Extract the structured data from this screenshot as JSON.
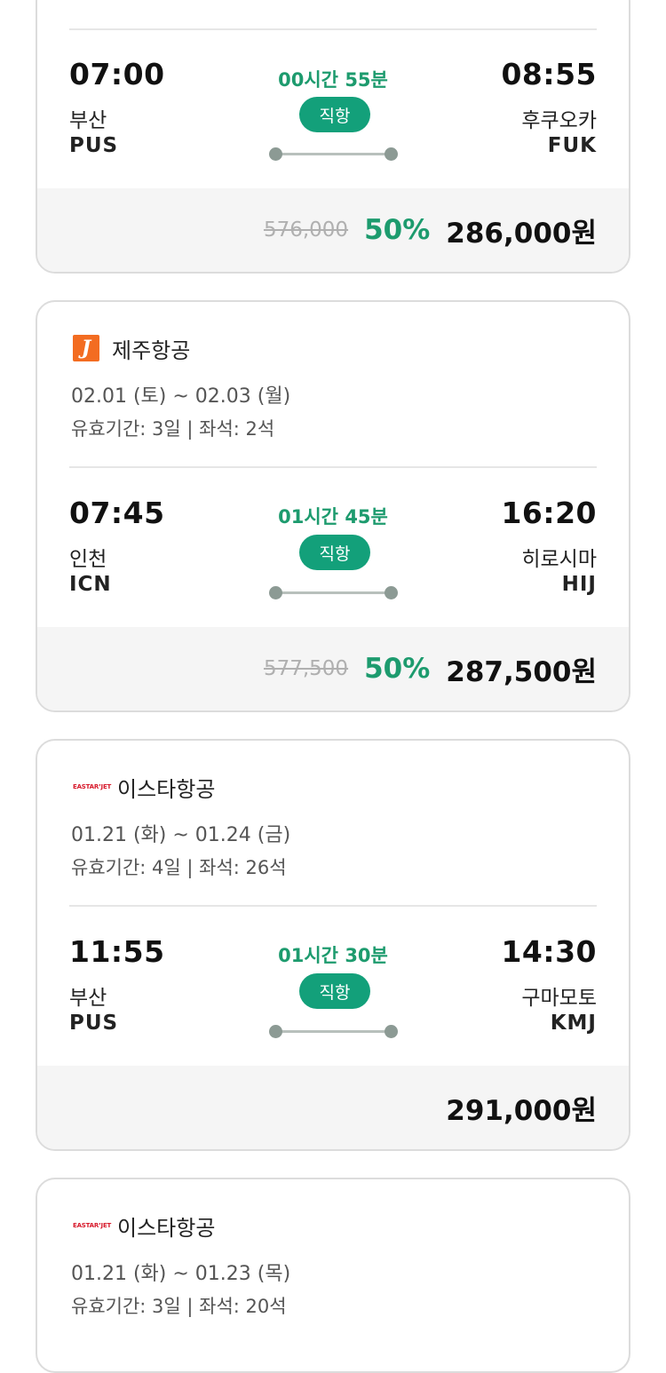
{
  "cards": [
    {
      "dep_time": "07:00",
      "dep_city": "부산",
      "dep_code": "PUS",
      "arr_time": "08:55",
      "arr_city": "후쿠오카",
      "arr_code": "FUK",
      "duration": "00시간 55분",
      "badge": "직항",
      "orig_price": "576,000",
      "discount": "50%",
      "price": "286,000원"
    },
    {
      "airline": "제주항공",
      "logo_letter": "J",
      "dates": "02.01 (토) ~ 02.03 (월)",
      "validity": "유효기간: 3일 | 좌석: 2석",
      "dep_time": "07:45",
      "dep_city": "인천",
      "dep_code": "ICN",
      "arr_time": "16:20",
      "arr_city": "히로시마",
      "arr_code": "HIJ",
      "duration": "01시간 45분",
      "badge": "직항",
      "orig_price": "577,500",
      "discount": "50%",
      "price": "287,500원"
    },
    {
      "airline": "이스타항공",
      "logo_text": "EASTAR’JET",
      "dates": "01.21 (화) ~ 01.24 (금)",
      "validity": "유효기간: 4일 | 좌석: 26석",
      "dep_time": "11:55",
      "dep_city": "부산",
      "dep_code": "PUS",
      "arr_time": "14:30",
      "arr_city": "구마모토",
      "arr_code": "KMJ",
      "duration": "01시간 30분",
      "badge": "직항",
      "price": "291,000원"
    },
    {
      "airline": "이스타항공",
      "logo_text": "EASTAR’JET",
      "dates": "01.21 (화) ~ 01.23 (목)",
      "validity": "유효기간: 3일 | 좌석: 20석"
    }
  ],
  "colors": {
    "accent": "#1d9b6e",
    "badge": "#13a07a",
    "jeju": "#f36c21",
    "eastar": "#d7182a"
  }
}
